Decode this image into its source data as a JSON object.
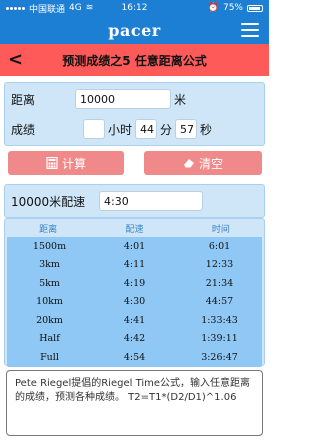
{
  "status": {
    "carrier": "中国联通",
    "network": "4G",
    "time": "16:12",
    "battery": "75%"
  },
  "app": {
    "brand": "pacer",
    "icons": [
      "menu-icon",
      "back-icon"
    ]
  },
  "page": {
    "title": "预测成绩之5 任意距离公式"
  },
  "form": {
    "distance_label": "距离",
    "distance_value": "10000",
    "distance_unit": "米",
    "time_label": "成绩",
    "hours_value": "",
    "hours_unit": "小时",
    "minutes_value": "44",
    "minutes_unit": "分",
    "seconds_value": "57",
    "seconds_unit": "秒"
  },
  "buttons": {
    "calc_label": "计算",
    "clear_label": "清空"
  },
  "pace": {
    "label": "10000米配速",
    "value": "4:30"
  },
  "table": {
    "headers": [
      "距离",
      "配速",
      "时间"
    ],
    "rows": [
      [
        "1500m",
        "4:01",
        "6:01"
      ],
      [
        "3km",
        "4:11",
        "12:33"
      ],
      [
        "5km",
        "4:19",
        "21:34"
      ],
      [
        "10km",
        "4:30",
        "44:57"
      ],
      [
        "20km",
        "4:41",
        "1:33:43"
      ],
      [
        "Half",
        "4:42",
        "1:39:11"
      ],
      [
        "Full",
        "4:54",
        "3:26:47"
      ]
    ]
  },
  "note": {
    "text": "Pete Riegel提倡的Riegel Time公式，输入任意距离的成绩，预测各种成绩。 T2=T1*(D2/D1)^1.06"
  }
}
